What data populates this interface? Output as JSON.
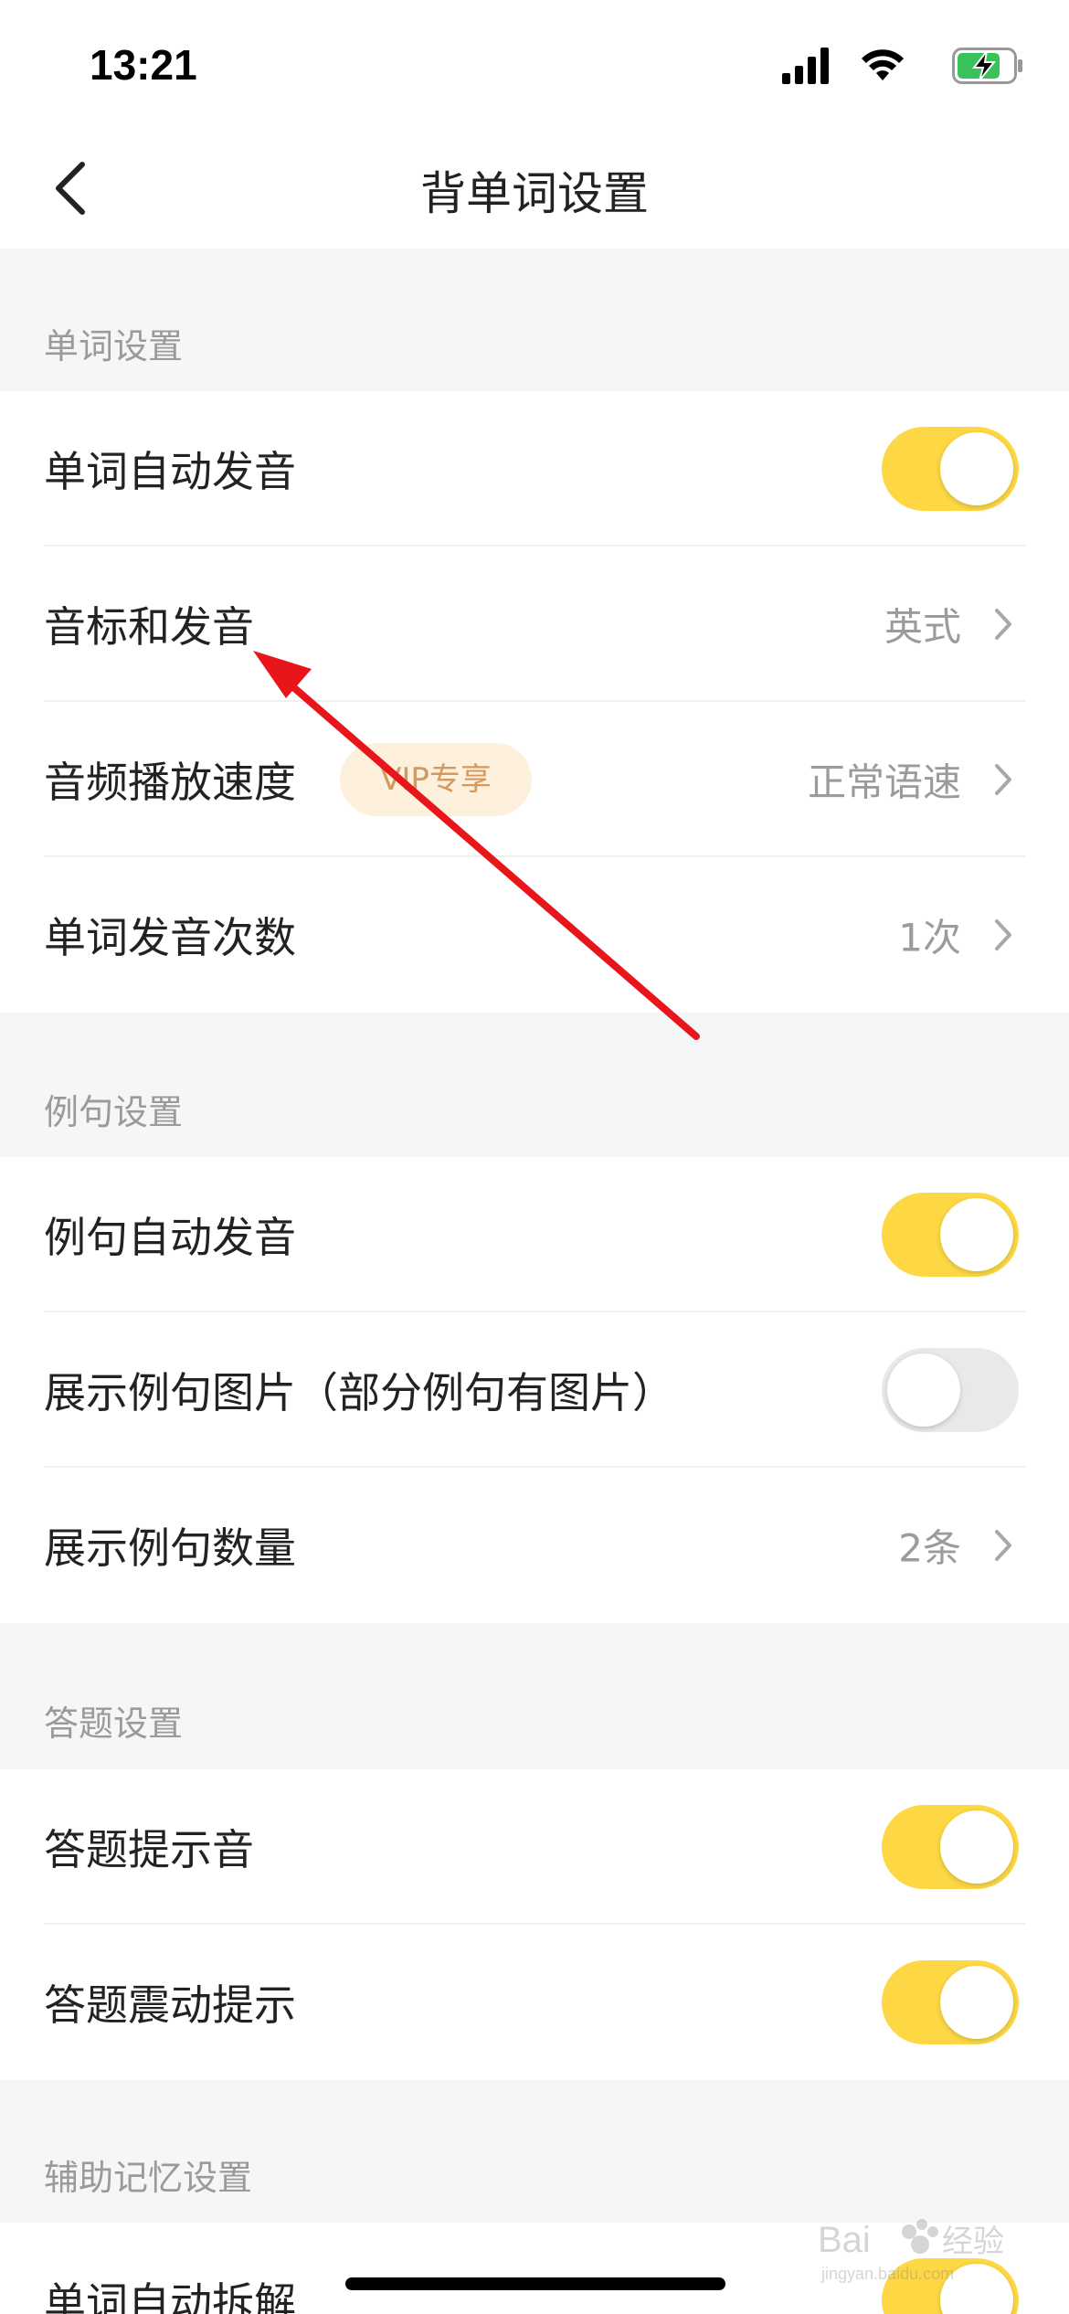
{
  "status_bar": {
    "time": "13:21"
  },
  "nav": {
    "title": "背单词设置"
  },
  "sections": [
    {
      "header": "单词设置",
      "rows": [
        {
          "label": "单词自动发音",
          "toggle": true
        },
        {
          "label": "音标和发音",
          "value": "英式"
        },
        {
          "label": "音频播放速度",
          "badge": "VIP专享",
          "value": "正常语速"
        },
        {
          "label": "单词发音次数",
          "value": "1次"
        }
      ]
    },
    {
      "header": "例句设置",
      "rows": [
        {
          "label": "例句自动发音",
          "toggle": true
        },
        {
          "label": "展示例句图片（部分例句有图片）",
          "toggle": false
        },
        {
          "label": "展示例句数量",
          "value": "2条"
        }
      ]
    },
    {
      "header": "答题设置",
      "rows": [
        {
          "label": "答题提示音",
          "toggle": true
        },
        {
          "label": "答题震动提示",
          "toggle": true
        }
      ]
    },
    {
      "header": "辅助记忆设置",
      "rows": [
        {
          "label": "单词自动拆解",
          "toggle": true
        }
      ]
    }
  ],
  "colors": {
    "accent": "#fdd844",
    "toggle_off": "#e9e9ea",
    "annotation_arrow": "#e8161b",
    "vip_badge_bg": "#fdf0dc",
    "vip_badge_text": "#d29a5d"
  },
  "watermark": {
    "brand": "Bai",
    "brand_suffix": "经验",
    "url": "jingyan.baidu.com"
  }
}
